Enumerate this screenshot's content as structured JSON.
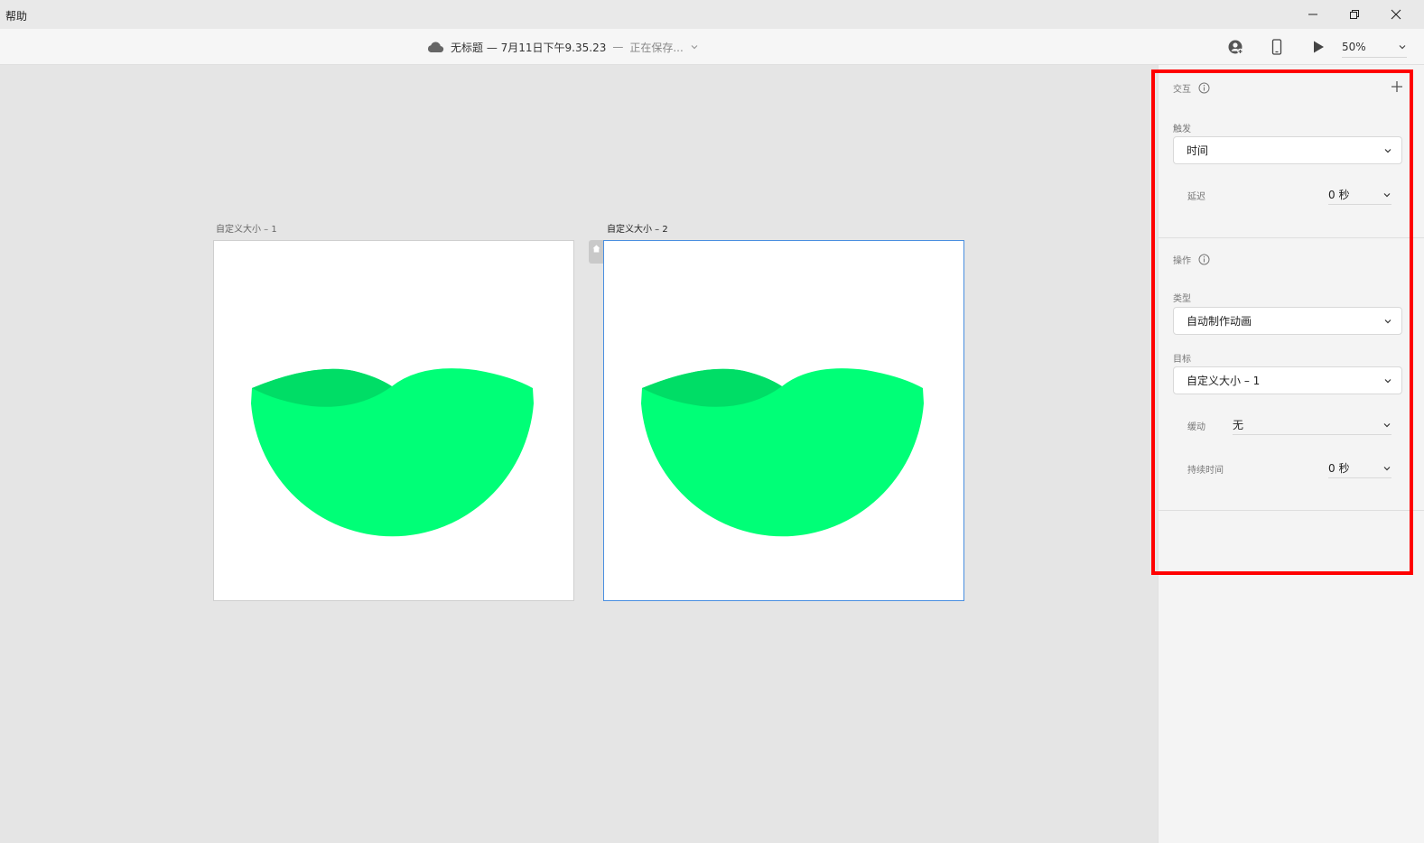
{
  "menu": {
    "help": "帮助"
  },
  "toolbar": {
    "doc_title": "无标题 — 7月11日下午9.35.23",
    "separator": "—",
    "save_status": "正在保存...",
    "zoom": "50%"
  },
  "artboards": [
    {
      "label": "自定义大小 – 1"
    },
    {
      "label": "自定义大小 – 2"
    }
  ],
  "colors": {
    "shape_main": "#00ff77",
    "shape_dark": "#00dd66",
    "selection": "#4a8fe0",
    "highlight": "#ff0000"
  },
  "interaction": {
    "title": "交互",
    "trigger_label": "触发",
    "trigger_value": "时间",
    "delay_label": "延迟",
    "delay_value": "0 秒"
  },
  "action": {
    "title": "操作",
    "type_label": "类型",
    "type_value": "自动制作动画",
    "target_label": "目标",
    "target_value": "自定义大小 – 1",
    "easing_label": "缓动",
    "easing_value": "无",
    "duration_label": "持续时间",
    "duration_value": "0 秒"
  }
}
